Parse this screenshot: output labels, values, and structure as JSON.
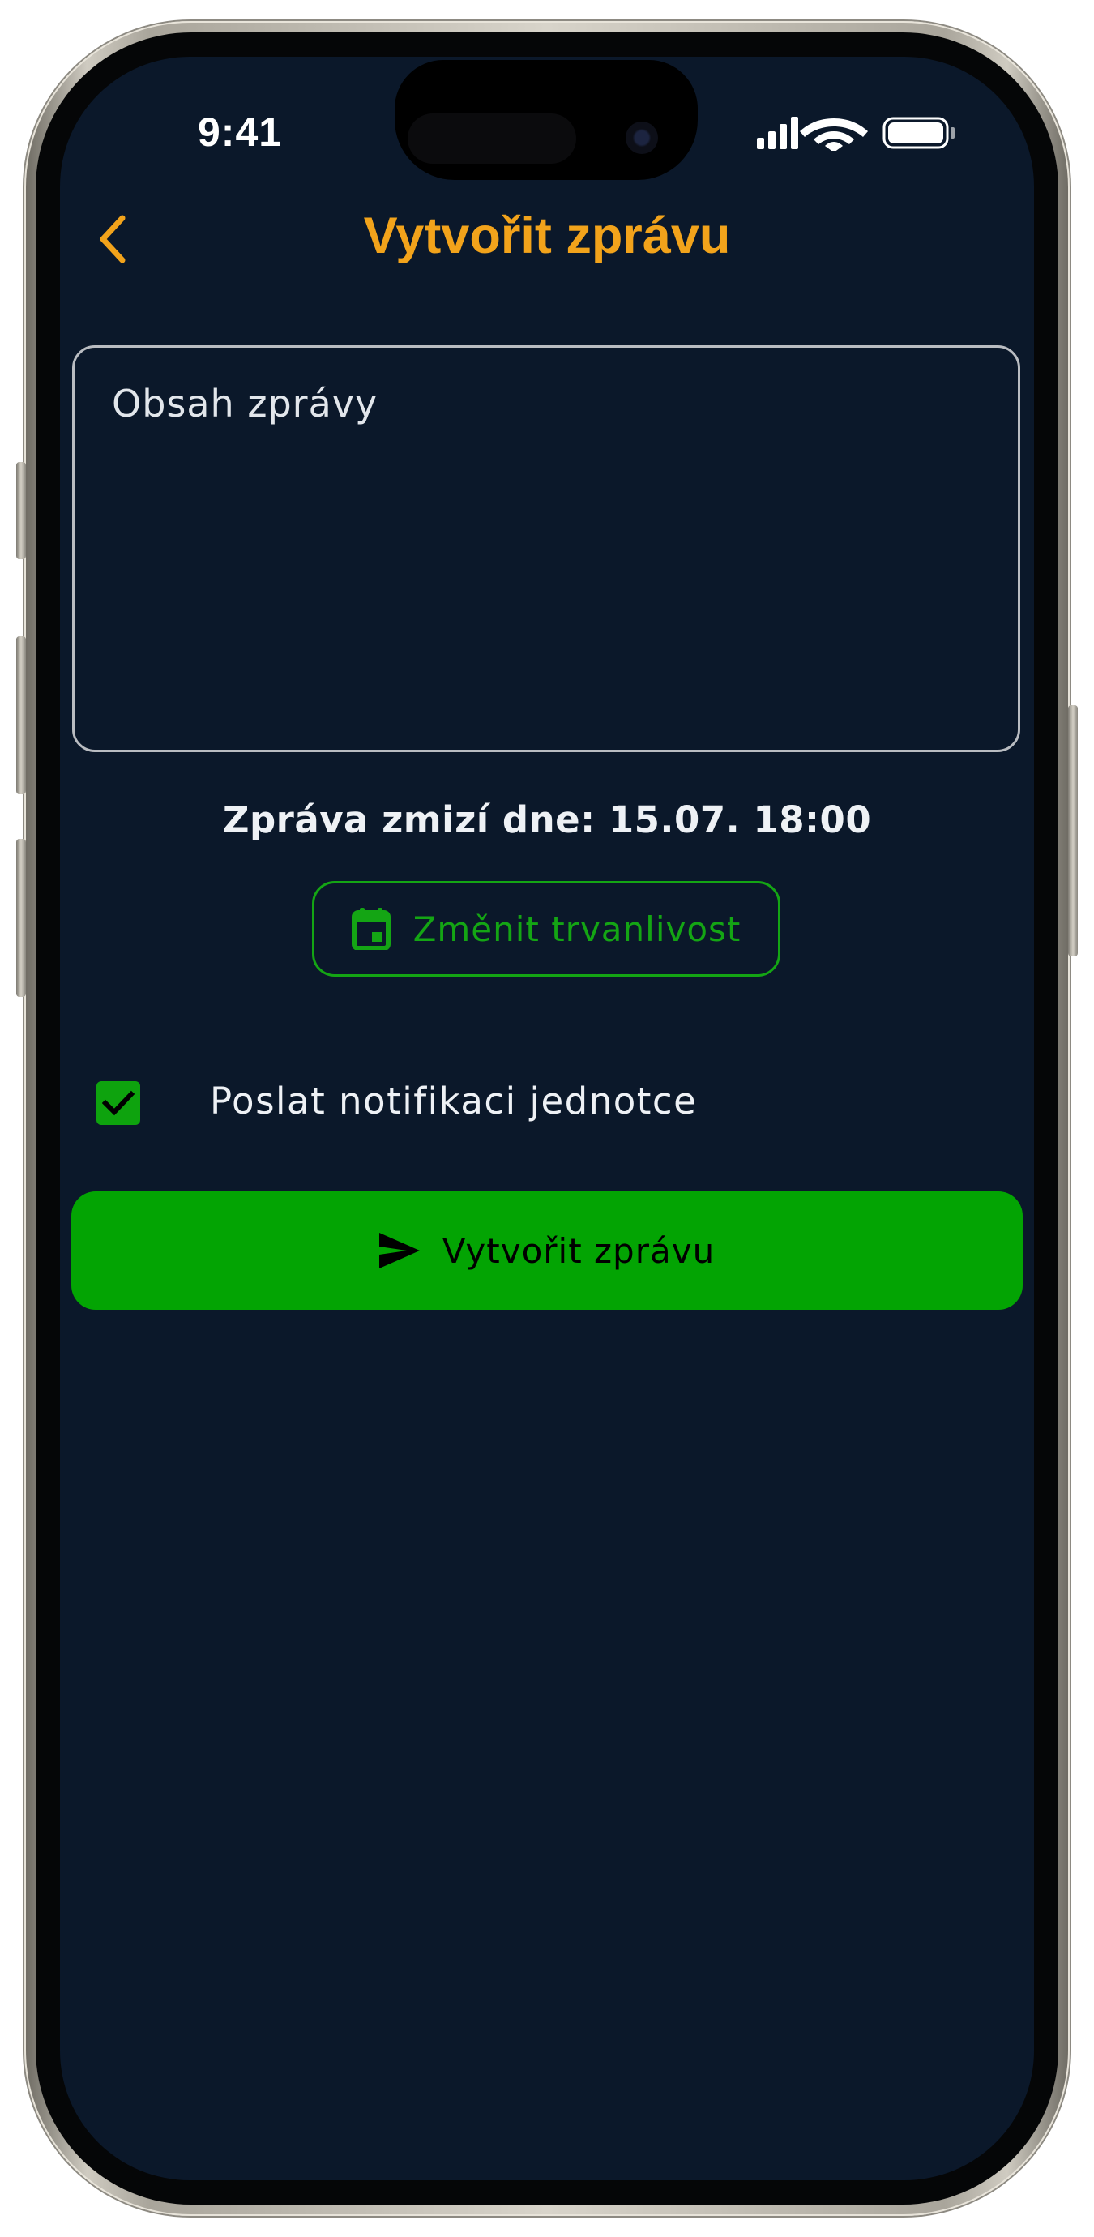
{
  "status_bar": {
    "time": "9:41",
    "signal_icon": "cellular-signal-icon",
    "wifi_icon": "wifi-icon",
    "battery_icon": "battery-icon"
  },
  "header": {
    "back_icon": "chevron-left-icon",
    "title": "Vytvořit zprávu",
    "title_color": "#f2a31b"
  },
  "form": {
    "message_placeholder": "Obsah zprávy",
    "message_value": "",
    "expiry_text": "Zpráva zmizí dne: 15.07. 18:00",
    "change_duration_icon": "calendar-icon",
    "change_duration_label": "Změnit trvanlivost",
    "notify_checked": true,
    "notify_label": "Poslat notifikaci jednotce",
    "submit_icon": "send-icon",
    "submit_label": "Vytvořit zprávu"
  },
  "colors": {
    "background": "#0b182a",
    "accent": "#f2a31b",
    "primary_green": "#03a403"
  }
}
